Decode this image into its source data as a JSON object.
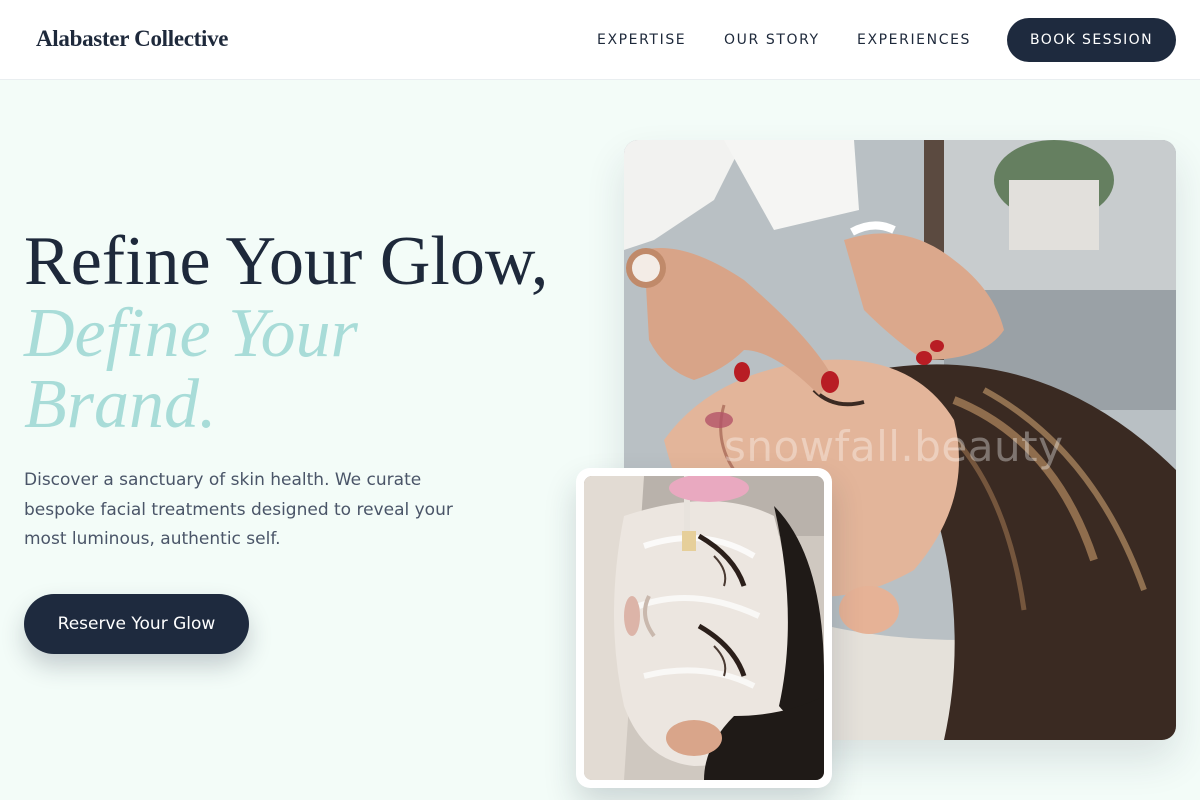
{
  "header": {
    "brand": "Alabaster Collective",
    "nav": [
      "EXPERTISE",
      "OUR STORY",
      "EXPERIENCES"
    ],
    "book_label": "BOOK SESSION"
  },
  "hero": {
    "headline": "Refine Your Glow,",
    "headline_accent": "Define Your Brand.",
    "subtext": "Discover a sanctuary of skin health. We curate bespoke facial treatments designed to reveal your most luminous, authentic self.",
    "cta_label": "Reserve Your Glow"
  },
  "images": {
    "main_watermark": "snowfall.beauty",
    "main_subject": "facial-massage-photo",
    "inset_subject": "face-mask-treatment-photo"
  },
  "colors": {
    "primary": "#1e2a3e",
    "accent": "#a8dcd8",
    "background": "#f3fcf8"
  }
}
